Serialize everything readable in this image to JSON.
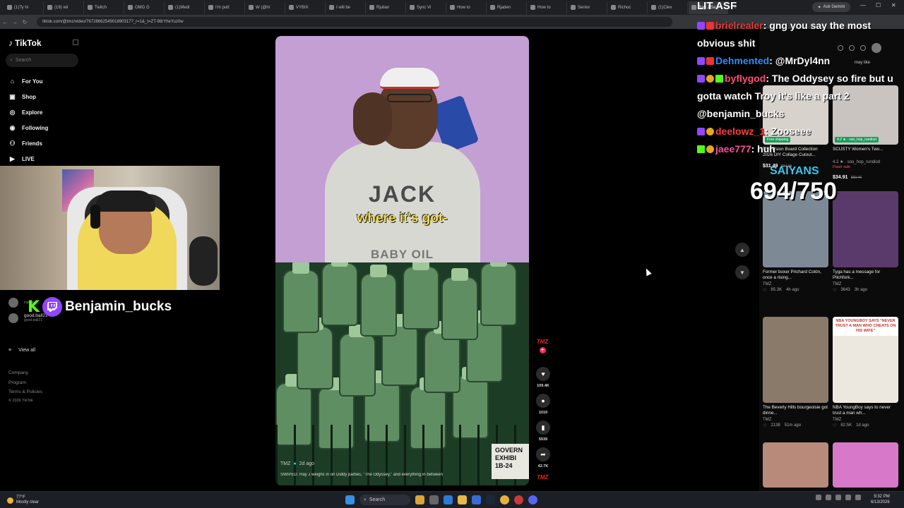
{
  "browser": {
    "tabs": [
      "(1)Ty hi",
      "(19) wii",
      "Twitch",
      "OMG G",
      "(1)Medi",
      "I'm putt",
      "W (@hi",
      "VYBIX",
      "I will be",
      "Rjulian",
      "Sync Vi",
      "How to",
      "Rjaden",
      "How to",
      "Senior",
      "Richoc",
      "(1)Clev",
      "Ray J Sa"
    ],
    "ask_gemini": "Ask Gemini",
    "url": "tiktok.com/@tmz/video/7672866254901890317?_r=1&_t=ZT-98rYheYuz0w"
  },
  "tiktok": {
    "logo": "TikTok",
    "search_placeholder": "Search",
    "nav": [
      {
        "label": "For You",
        "icon": "home-icon"
      },
      {
        "label": "Shop",
        "icon": "shop-icon"
      },
      {
        "label": "Explore",
        "icon": "compass-icon"
      },
      {
        "label": "Following",
        "icon": "following-icon"
      },
      {
        "label": "Friends",
        "icon": "friends-icon"
      },
      {
        "label": "LIVE",
        "icon": "live-icon"
      }
    ],
    "following_accounts": [
      {
        "name": "",
        "handle": "injanay"
      },
      {
        "name": "good.ball21",
        "handle": "good.ball21"
      }
    ],
    "view_all": "View all",
    "footer": [
      "Company",
      "Program",
      "Terms & Policies",
      "© 2026 TikTok"
    ]
  },
  "stream": {
    "streamer_name": "Benjamin_bucks",
    "title": "LIT ASF",
    "chat": [
      {
        "user": "brielrealer",
        "message": "gng you say the most obvious shit"
      },
      {
        "user": "Dehmented",
        "message": "@MrDyl4nn"
      },
      {
        "user": "byflygod",
        "message": "The Oddysey so fire but u gotta watch Troy it's like a part 2 @benjamin_bucks"
      },
      {
        "user": "deelowz_1",
        "message": "Zooseee"
      },
      {
        "user": "jaee777",
        "message": "huh"
      }
    ],
    "goal_label": "SAIYANS",
    "goal_progress": "694/750"
  },
  "video": {
    "shirt_text": "JACK",
    "caption": "where it's got-",
    "overlay_text": "BABY OIL",
    "exhibit": [
      "GOVERN",
      "EXHIBI",
      "1B-24"
    ],
    "author": "TMZ",
    "age": "2d ago",
    "description": "SWIPED: Ray J weighs in on Diddy parties, \"The Odyssey,\" and everything in between",
    "channel_avatar": "TMZ",
    "likes": "109.4K",
    "comments": "1019",
    "saves": "5939",
    "shares": "42.7K"
  },
  "recommendations": {
    "header": "may like",
    "cards": [
      {
        "title": "The Vision Board Collection 2026 DIY Collage Cutout...",
        "meta": "Free shipping",
        "price": "$31.49",
        "old_price": "$34.99",
        "thumb": "#d8d2cc"
      },
      {
        "title": "SCUSTY Women's Two...",
        "meta": "4.2 ★ · soo_hop_rundiod",
        "flash": "Flash sale",
        "price": "$34.91",
        "old_price": "$69.46",
        "thumb": "#c9c4c0"
      },
      {
        "title": "Former boxer Prichard Colón, once a rising...",
        "author": "TMZ",
        "views": "85.3K",
        "age": "4h ago",
        "thumb": "#7d8a96"
      },
      {
        "title": "Tyga has a message for Pitchfork...",
        "author": "TMZ",
        "views": "3643",
        "age": "3h ago",
        "thumb": "#5a3a6a"
      },
      {
        "title": "The Beverly Hills bourgeoisie got dinne...",
        "author": "TMZ",
        "views": "2138",
        "age": "51m ago",
        "thumb": "#8a7a6a"
      },
      {
        "title": "NBA YoungBoy says to never trust a man wh...",
        "author": "TMZ",
        "views": "82.5K",
        "age": "1d ago",
        "thumb": "#ece8e0",
        "banner": "NBA YOUNGBOY SAYS \"NEVER TRUST A MAN WHO CHEATS ON HIS WIFE\""
      },
      {
        "title": "",
        "thumb": "#b88a7a"
      },
      {
        "title": "",
        "thumb": "#d878c8"
      }
    ]
  },
  "taskbar": {
    "temp": "77°F",
    "weather": "Mostly clear",
    "search": "Search",
    "time": "9:32 PM",
    "date": "6/13/2026"
  }
}
